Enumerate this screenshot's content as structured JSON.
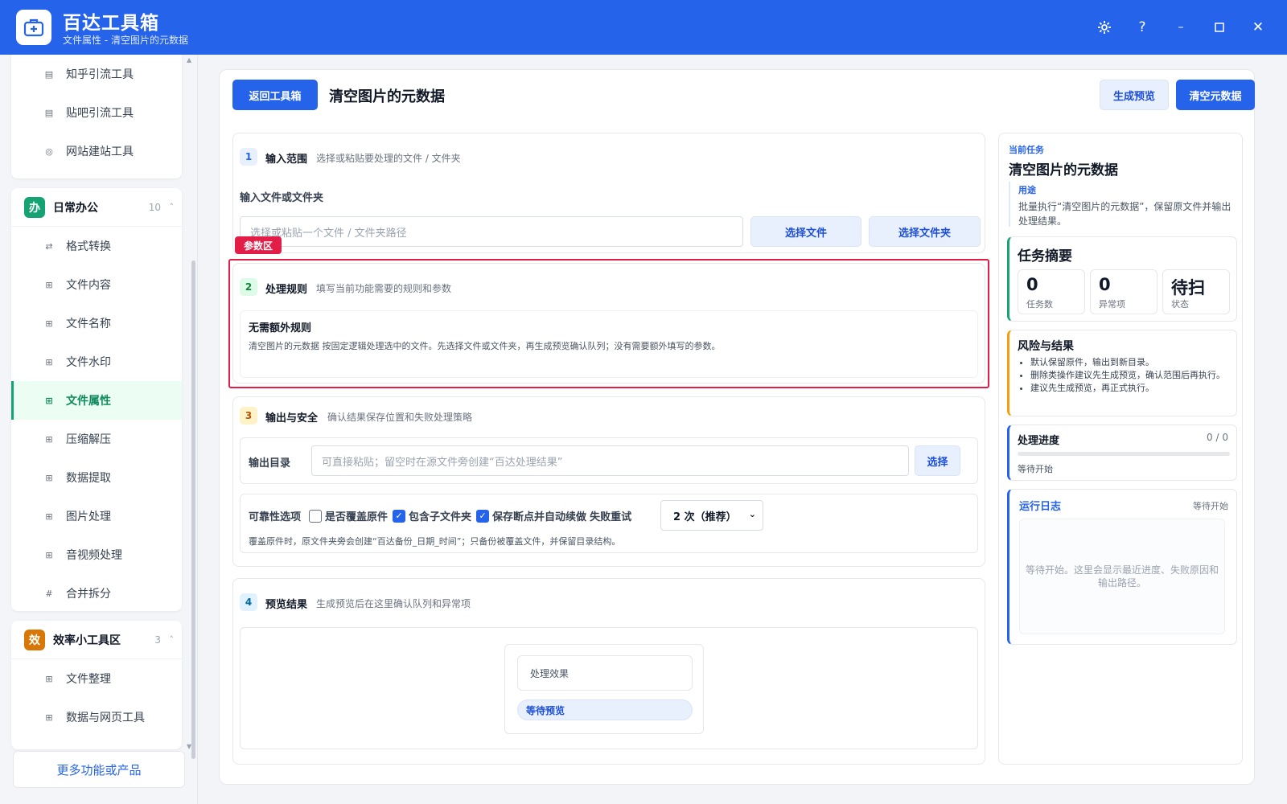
{
  "titlebar": {
    "app_name": "百达工具箱",
    "subtitle": "文件属性 - 清空图片的元数据"
  },
  "sidebar": {
    "top_items": [
      {
        "label": "知乎引流工具",
        "icon": "zhihu-icon"
      },
      {
        "label": "贴吧引流工具",
        "icon": "tieba-icon"
      },
      {
        "label": "网站建站工具",
        "icon": "website-icon"
      }
    ],
    "group_office": {
      "badge": "办",
      "title": "日常办公",
      "count": "10",
      "badge_color": "#16a374"
    },
    "office_items": [
      {
        "label": "格式转换",
        "icon": "convert-icon"
      },
      {
        "label": "文件内容",
        "icon": "grid-icon"
      },
      {
        "label": "文件名称",
        "icon": "grid-icon"
      },
      {
        "label": "文件水印",
        "icon": "grid-icon"
      },
      {
        "label": "文件属性",
        "icon": "grid-icon"
      },
      {
        "label": "压缩解压",
        "icon": "grid-icon"
      },
      {
        "label": "数据提取",
        "icon": "grid-icon"
      },
      {
        "label": "图片处理",
        "icon": "grid-icon"
      },
      {
        "label": "音视频处理",
        "icon": "grid-icon"
      },
      {
        "label": "合并拆分",
        "icon": "hash-icon"
      }
    ],
    "group_efficiency": {
      "badge": "效",
      "title": "效率小工具区",
      "count": "3",
      "badge_color": "#d97706"
    },
    "efficiency_items": [
      {
        "label": "文件整理",
        "icon": "grid-icon"
      },
      {
        "label": "数据与网页工具",
        "icon": "grid-icon"
      }
    ],
    "more_label": "更多功能或产品"
  },
  "toolbar": {
    "back_label": "返回工具箱",
    "page_title": "清空图片的元数据",
    "preview_label": "生成预览",
    "run_label": "清空元数据"
  },
  "step1": {
    "no": "1",
    "title": "输入范围",
    "desc": "选择或粘贴要处理的文件 / 文件夹",
    "field_label": "输入文件或文件夹",
    "placeholder": "选择或粘贴一个文件 / 文件夹路径",
    "choose_file": "选择文件",
    "choose_folder": "选择文件夹"
  },
  "param_tag": "参数区",
  "step2": {
    "no": "2",
    "title": "处理规则",
    "desc": "填写当前功能需要的规则和参数",
    "rule_title": "无需额外规则",
    "rule_desc": "清空图片的元数据 按固定逻辑处理选中的文件。先选择文件或文件夹，再生成预览确认队列；没有需要额外填写的参数。"
  },
  "step3": {
    "no": "3",
    "title": "输出与安全",
    "desc": "确认结果保存位置和失败处理策略",
    "output_label": "输出目录",
    "output_placeholder": "可直接粘贴；留空时在源文件旁创建“百达处理结果”",
    "choose_label": "选择",
    "reliability_label": "可靠性选项",
    "opt_overwrite": "是否覆盖原件",
    "opt_subfolder": "包含子文件夹",
    "opt_resume": "保存断点并自动续做",
    "retry_label": "失败重试",
    "retry_value": "2 次（推荐）",
    "note": "覆盖原件时，原文件夹旁会创建“百达备份_日期_时间”；只备份被覆盖文件，并保留目录结构。"
  },
  "step4": {
    "no": "4",
    "title": "预览结果",
    "desc": "生成预览后在这里确认队列和异常项",
    "effect_label": "处理效果",
    "waiting_label": "等待预览"
  },
  "panel": {
    "current_task_label": "当前任务",
    "task_title": "清空图片的元数据",
    "purpose_label": "用途",
    "purpose_text": "批量执行“清空图片的元数据”，保留原文件并输出处理结果。",
    "summary_title": "任务摘要",
    "stats": [
      {
        "value": "0",
        "label": "任务数"
      },
      {
        "value": "0",
        "label": "异常项"
      },
      {
        "value": "待扫",
        "label": "状态"
      }
    ],
    "risk_title": "风险与结果",
    "risks": [
      "默认保留原件，输出到新目录。",
      "删除类操作建议先生成预览，确认范围后再执行。",
      "建议先生成预览，再正式执行。"
    ],
    "progress_title": "处理进度",
    "progress_value": "0 / 0",
    "progress_fraction": 0,
    "progress_status": "等待开始",
    "log_title": "运行日志",
    "log_status": "等待开始",
    "log_placeholder": "等待开始。这里会显示最近进度、失败原因和输出路径。"
  }
}
